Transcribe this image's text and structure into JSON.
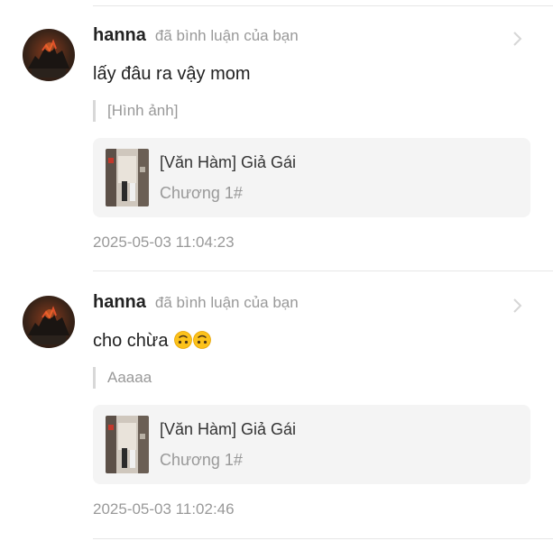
{
  "notifications": [
    {
      "username": "hanna",
      "action": "đã bình luận của bạn",
      "comment": "lấy đâu ra vậy mom",
      "emojis": [],
      "quote": "[Hình ảnh]",
      "card": {
        "title": "[Văn Hàm] Giả Gái",
        "subtitle": "Chương 1#"
      },
      "timestamp": "2025-05-03 11:04:23"
    },
    {
      "username": "hanna",
      "action": "đã bình luận của bạn",
      "comment": "cho chừa",
      "emojis": [
        "upside-down-face",
        "upside-down-face"
      ],
      "quote": "Aaaaa",
      "card": {
        "title": "[Văn Hàm] Giả Gái",
        "subtitle": "Chương 1#"
      },
      "timestamp": "2025-05-03 11:02:46"
    }
  ],
  "icons": {
    "avatar": "avatar-image",
    "chevron": "chevron-right-icon",
    "thumbnail": "book-cover-thumbnail"
  },
  "colors": {
    "muted": "#999999",
    "card_bg": "#f4f4f4",
    "divider": "#e6e6e6"
  }
}
